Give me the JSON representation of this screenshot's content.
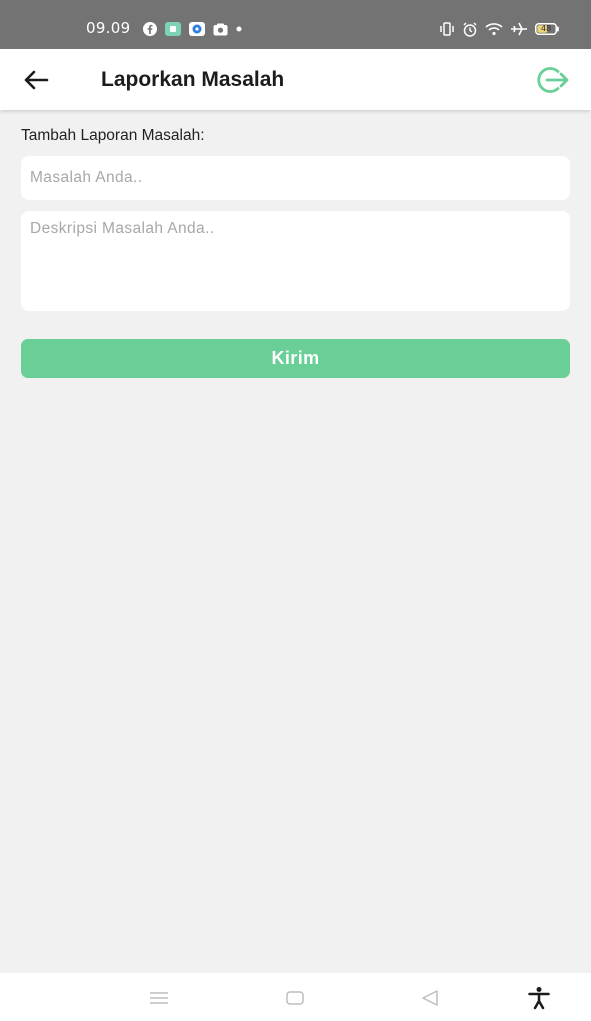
{
  "status_bar": {
    "time": "09.09",
    "battery": "48",
    "left_icons": [
      "facebook-icon",
      "app-notification-icon",
      "messenger-icon",
      "photo-icon",
      "more-dot-icon"
    ],
    "right_icons": [
      "vibrate-icon",
      "alarm-icon",
      "wifi-icon",
      "airplane-icon",
      "battery-icon"
    ]
  },
  "app_bar": {
    "title": "Laporkan Masalah",
    "back_icon": "arrow-left-icon",
    "logout_icon": "logout-icon"
  },
  "form": {
    "section_label": "Tambah Laporan Masalah:",
    "title_field": {
      "value": "",
      "placeholder": "Masalah Anda.."
    },
    "description_field": {
      "value": "",
      "placeholder": "Deskripsi Masalah Anda.."
    },
    "submit_label": "Kirim"
  },
  "colors": {
    "accent": "#6acf96",
    "status_bar": "#737373",
    "background": "#f1f1f1"
  },
  "nav_bar": {
    "icons": [
      "recent-apps-icon",
      "home-icon",
      "back-icon",
      "accessibility-icon"
    ]
  }
}
